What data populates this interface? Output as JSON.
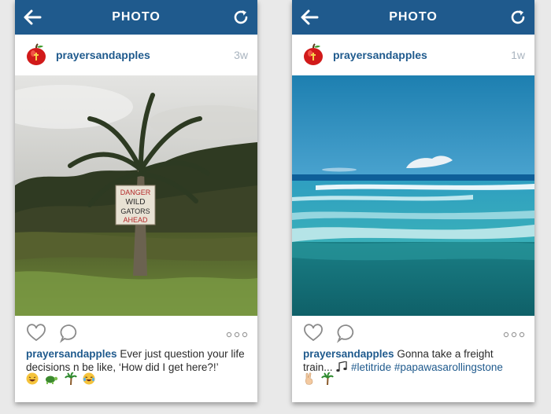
{
  "posts": [
    {
      "header": {
        "title": "PHOTO"
      },
      "username": "prayersandapples",
      "time": "3w",
      "photo": {
        "description_sign": [
          "DANGER",
          "WILD",
          "GATORS",
          "AHEAD"
        ]
      },
      "caption": {
        "user": "prayersandapples",
        "text": "Ever just question your life decisions n be like, ‘How did I get here?!’",
        "emojis": [
          "laughing-face-icon",
          "turtle-icon",
          "palm-tree-icon",
          "crying-laughing-face-icon"
        ]
      }
    },
    {
      "header": {
        "title": "PHOTO"
      },
      "username": "prayersandapples",
      "time": "1w",
      "caption": {
        "user": "prayersandapples",
        "text": "Gonna take a freight train...",
        "tags": "#letitride #papawasarollingstone",
        "emojis": [
          "victory-hand-icon",
          "palm-tree-icon"
        ]
      }
    }
  ],
  "colors": {
    "topbar": "#1f5a8d",
    "link": "#1f5a8d",
    "muted": "#a9b4bf"
  }
}
